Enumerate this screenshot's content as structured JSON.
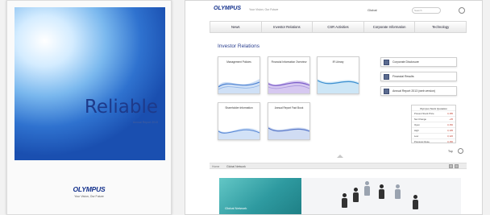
{
  "cover": {
    "title": "Reliable",
    "subtitle": "Annual Report 2013",
    "logo": "OLYMPUS",
    "tagline": "Your Vision, Our Future"
  },
  "site": {
    "header": {
      "logo": "OLYMPUS",
      "tagline": "Your Vision, Our Future",
      "language": "Global",
      "search_placeholder": "Search"
    },
    "nav": [
      {
        "label": "News"
      },
      {
        "label": "Investor Relations"
      },
      {
        "label": "CSR Activities"
      },
      {
        "label": "Corporate Information"
      },
      {
        "label": "Technology"
      }
    ],
    "section_title": "Investor Relations",
    "tiles": [
      {
        "label": "Management Policies"
      },
      {
        "label": "Financial Information Overview"
      },
      {
        "label": "IR Library"
      },
      {
        "label": "Shareholder Information"
      },
      {
        "label": "Annual Report Fact Book"
      }
    ],
    "links": [
      {
        "label": "Corporate Disclosure"
      },
      {
        "label": "Financial Results"
      },
      {
        "label": "Annual Report 2013 (web version)"
      }
    ],
    "stock": {
      "title": "Olympus Stock Quotation",
      "rows": [
        {
          "label": "Present Stock Price",
          "value": "3,185"
        },
        {
          "label": "Net Change",
          "value": "+35"
        },
        {
          "label": "Open",
          "value": "3,150"
        },
        {
          "label": "High",
          "value": "3,195"
        },
        {
          "label": "Low",
          "value": "3,120"
        },
        {
          "label": "Previous Close",
          "value": "3,150"
        }
      ]
    },
    "top_link": "Top",
    "breadcrumb": {
      "home": "Home",
      "current": "Global Network"
    },
    "banner": {
      "text": "Global Network"
    }
  }
}
